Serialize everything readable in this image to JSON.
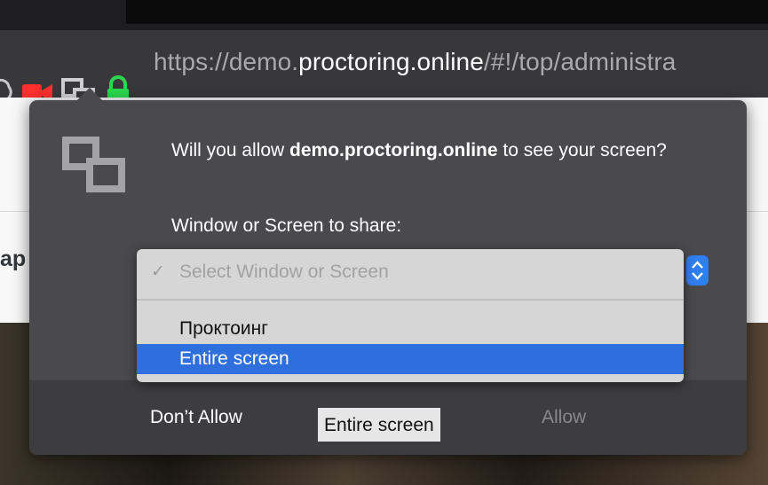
{
  "browser": {
    "url": {
      "prefix": "https://demo.",
      "host": "proctoring.online",
      "suffix": "/#!/top/administra"
    },
    "icons": [
      "camera-icon",
      "screen-share-icon",
      "lock-icon"
    ],
    "colors": {
      "camera": "#ff2f2f",
      "lock": "#2bd74f",
      "screen_share": "#cfcfd2"
    }
  },
  "page": {
    "heading_fragment": "ap"
  },
  "dialog": {
    "prompt_prefix": "Will you allow ",
    "prompt_site": "demo.proctoring.online",
    "prompt_suffix": " to see your screen?",
    "share_label": "Window or Screen to share:",
    "select": {
      "placeholder": "Select Window or Screen",
      "options": [
        "Проктоинг",
        "Entire screen"
      ],
      "highlighted": "Entire screen"
    },
    "buttons": {
      "deny": "Don’t Allow",
      "selected_source": "Entire screen",
      "allow": "Allow"
    },
    "colors": {
      "highlight": "#2f6edd",
      "spinner": "#2f7ff0"
    }
  }
}
